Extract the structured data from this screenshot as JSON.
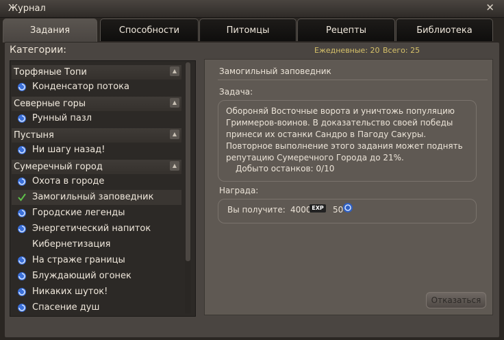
{
  "window": {
    "title": "Журнал"
  },
  "tabs": [
    "Задания",
    "Способности",
    "Питомцы",
    "Рецепты",
    "Библиотека"
  ],
  "categories_label": "Категории:",
  "counts": {
    "daily": "Ежедневные: 20",
    "total": "Всего: 25"
  },
  "groups": [
    {
      "name": "Торфяные Топи",
      "items": [
        {
          "label": "Конденсатор потока",
          "icon": "swirl-icon"
        }
      ]
    },
    {
      "name": "Северные горы",
      "items": [
        {
          "label": "Рунный пазл",
          "icon": "swirl-icon"
        }
      ]
    },
    {
      "name": "Пустыня",
      "items": [
        {
          "label": "Ни шагу назад!",
          "icon": "swirl-icon"
        }
      ]
    },
    {
      "name": "Сумеречный город",
      "items": [
        {
          "label": "Охота в городе",
          "icon": "swirl-icon"
        },
        {
          "label": "Замогильный заповедник",
          "icon": "check-icon",
          "selected": true
        },
        {
          "label": "Городские легенды",
          "icon": "swirl-icon"
        },
        {
          "label": "Энергетический напиток",
          "icon": "swirl-icon"
        },
        {
          "label": "Кибернетизация",
          "icon": "none"
        },
        {
          "label": "На страже границы",
          "icon": "swirl-icon"
        },
        {
          "label": "Блуждающий огонек",
          "icon": "swirl-icon"
        },
        {
          "label": "Никаких шуток!",
          "icon": "swirl-icon"
        },
        {
          "label": "Спасение душ",
          "icon": "swirl-icon"
        }
      ]
    }
  ],
  "quest": {
    "title": "Замогильный заповедник",
    "task_heading": "Задача:",
    "task_text": "Обороняй Восточные ворота и уничтожь популяцию Гриммеров-воинов. В доказательство своей победы принеси их останки Сандро в Пагоду Сакуры.  Повторное выполнение этого задания может поднять репутацию Сумеречного Города до 21%.",
    "progress": "Добыто останков: 0/10",
    "reward_heading": "Награда:",
    "reward_label": "Вы получите:",
    "reward_exp": "4000",
    "exp_badge": "EXP",
    "reward_coins": "50",
    "refuse_button": "Отказаться"
  },
  "colors": {
    "accent_yellow": "#d7c26a",
    "icon_blue": "#3a6fd8",
    "check_green": "#5fc24a"
  }
}
